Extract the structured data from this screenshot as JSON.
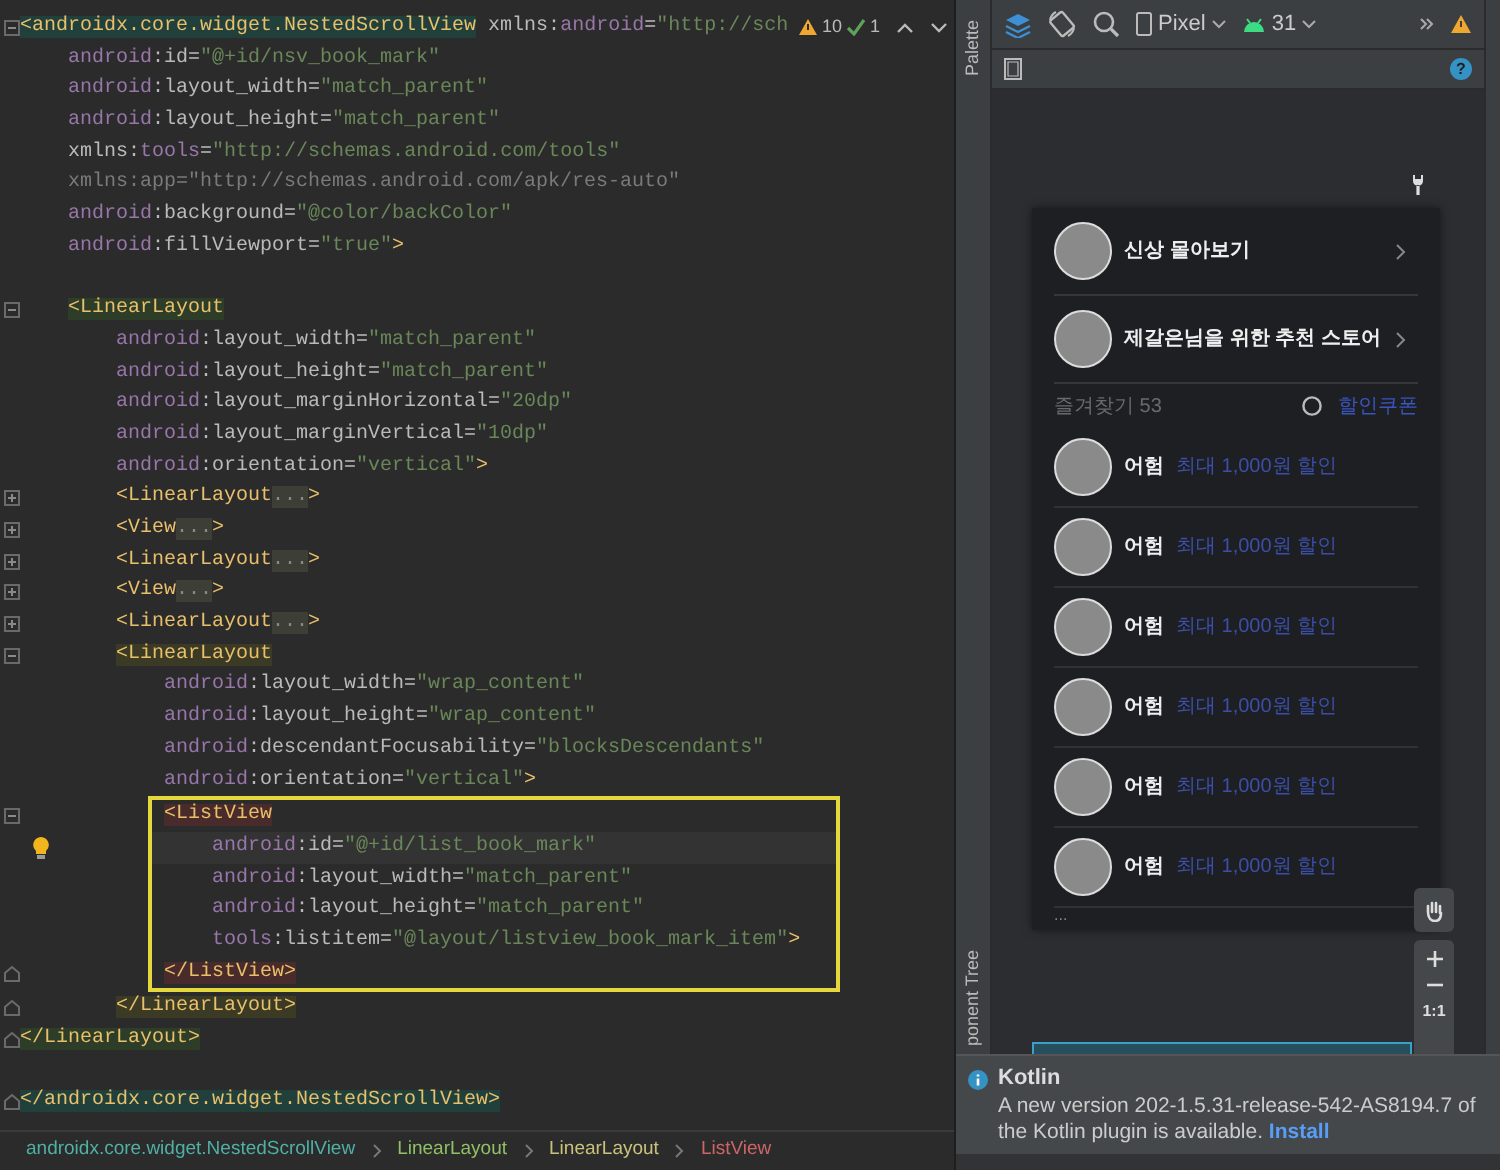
{
  "editor": {
    "inspections": {
      "warnings": "10",
      "weak_warnings": "1"
    },
    "lines": [
      {
        "kind": "code",
        "collapsed": false,
        "tokens": [
          {
            "kind": "tag",
            "text": "<androidx.core.widget.NestedScrollView",
            "color": "#22403b"
          },
          {
            "kind": "attr",
            "text": " xmlns:"
          },
          {
            "kind": "ns",
            "text": "android"
          },
          {
            "kind": "attr",
            "text": "="
          },
          {
            "kind": "val",
            "text": "\"http://sch"
          }
        ],
        "children": [
          {
            "kind": "code",
            "tokens": [
              {
                "kind": "ns",
                "text": "android"
              },
              {
                "kind": "attr",
                "text": ":id="
              },
              {
                "kind": "val",
                "text": "\"@+id/nsv_book_mark\""
              }
            ]
          },
          {
            "kind": "code",
            "tokens": [
              {
                "kind": "ns",
                "text": "android"
              },
              {
                "kind": "attr",
                "text": ":layout_width="
              },
              {
                "kind": "val",
                "text": "\"match_parent\""
              }
            ]
          },
          {
            "kind": "code",
            "tokens": [
              {
                "kind": "ns",
                "text": "android"
              },
              {
                "kind": "attr",
                "text": ":layout_height="
              },
              {
                "kind": "val",
                "text": "\"match_parent\""
              }
            ]
          },
          {
            "kind": "code",
            "tokens": [
              {
                "kind": "attr",
                "text": "xmlns:"
              },
              {
                "kind": "ns",
                "text": "tools"
              },
              {
                "kind": "attr",
                "text": "="
              },
              {
                "kind": "val",
                "text": "\"http://schemas.android.com/tools\""
              }
            ]
          },
          {
            "kind": "code",
            "tokens": [
              {
                "kind": "dim",
                "text": "xmlns:app=\"http://schemas.android.com/apk/res-auto\""
              }
            ]
          },
          {
            "kind": "code",
            "tokens": [
              {
                "kind": "ns",
                "text": "android"
              },
              {
                "kind": "attr",
                "text": ":background="
              },
              {
                "kind": "val",
                "text": "\"@color/backColor\""
              }
            ]
          },
          {
            "kind": "code",
            "tokens": [
              {
                "kind": "ns",
                "text": "android"
              },
              {
                "kind": "attr",
                "text": ":fillViewport="
              },
              {
                "kind": "val",
                "text": "\"true\""
              },
              {
                "kind": "tag",
                "text": ">"
              }
            ]
          },
          {
            "kind": "blank"
          },
          {
            "kind": "code",
            "collapsed": false,
            "tokens": [
              {
                "kind": "tag",
                "text": "<LinearLayout",
                "color": "#2e3d28"
              }
            ],
            "children": [
              {
                "kind": "code",
                "tokens": [
                  {
                    "kind": "ns",
                    "text": "android"
                  },
                  {
                    "kind": "attr",
                    "text": ":layout_width="
                  },
                  {
                    "kind": "val",
                    "text": "\"match_parent\""
                  }
                ]
              },
              {
                "kind": "code",
                "tokens": [
                  {
                    "kind": "ns",
                    "text": "android"
                  },
                  {
                    "kind": "attr",
                    "text": ":layout_height="
                  },
                  {
                    "kind": "val",
                    "text": "\"match_parent\""
                  }
                ]
              },
              {
                "kind": "code",
                "tokens": [
                  {
                    "kind": "ns",
                    "text": "android"
                  },
                  {
                    "kind": "attr",
                    "text": ":layout_marginHorizontal="
                  },
                  {
                    "kind": "val",
                    "text": "\"20dp\""
                  }
                ]
              },
              {
                "kind": "code",
                "tokens": [
                  {
                    "kind": "ns",
                    "text": "android"
                  },
                  {
                    "kind": "attr",
                    "text": ":layout_marginVertical="
                  },
                  {
                    "kind": "val",
                    "text": "\"10dp\""
                  }
                ]
              },
              {
                "kind": "code",
                "tokens": [
                  {
                    "kind": "ns",
                    "text": "android"
                  },
                  {
                    "kind": "attr",
                    "text": ":orientation="
                  },
                  {
                    "kind": "val",
                    "text": "\"vertical\""
                  },
                  {
                    "kind": "tag",
                    "text": ">"
                  }
                ]
              },
              {
                "kind": "code",
                "collapsed": true,
                "tokens": [
                  {
                    "kind": "tag",
                    "text": "<LinearLayout"
                  },
                  {
                    "kind": "fold",
                    "text": "..."
                  },
                  {
                    "kind": "tag",
                    "text": ">"
                  }
                ]
              },
              {
                "kind": "code",
                "collapsed": true,
                "tokens": [
                  {
                    "kind": "tag",
                    "text": "<View"
                  },
                  {
                    "kind": "fold",
                    "text": "..."
                  },
                  {
                    "kind": "tag",
                    "text": ">"
                  }
                ]
              },
              {
                "kind": "code",
                "collapsed": true,
                "tokens": [
                  {
                    "kind": "tag",
                    "text": "<LinearLayout"
                  },
                  {
                    "kind": "fold",
                    "text": "..."
                  },
                  {
                    "kind": "tag",
                    "text": ">"
                  }
                ]
              },
              {
                "kind": "code",
                "collapsed": true,
                "tokens": [
                  {
                    "kind": "tag",
                    "text": "<View"
                  },
                  {
                    "kind": "fold",
                    "text": "..."
                  },
                  {
                    "kind": "tag",
                    "text": ">"
                  }
                ]
              },
              {
                "kind": "code",
                "collapsed": true,
                "tokens": [
                  {
                    "kind": "tag",
                    "text": "<LinearLayout"
                  },
                  {
                    "kind": "fold",
                    "text": "..."
                  },
                  {
                    "kind": "tag",
                    "text": ">"
                  }
                ]
              },
              {
                "kind": "code",
                "collapsed": false,
                "tokens": [
                  {
                    "kind": "tag",
                    "text": "<LinearLayout",
                    "color": "#3b3a25"
                  }
                ],
                "children": [
                  {
                    "kind": "code",
                    "tokens": [
                      {
                        "kind": "ns",
                        "text": "android"
                      },
                      {
                        "kind": "attr",
                        "text": ":layout_width="
                      },
                      {
                        "kind": "val",
                        "text": "\"wrap_content\""
                      }
                    ]
                  },
                  {
                    "kind": "code",
                    "tokens": [
                      {
                        "kind": "ns",
                        "text": "android"
                      },
                      {
                        "kind": "attr",
                        "text": ":layout_height="
                      },
                      {
                        "kind": "val",
                        "text": "\"wrap_content\""
                      }
                    ]
                  },
                  {
                    "kind": "code",
                    "tokens": [
                      {
                        "kind": "ns",
                        "text": "android"
                      },
                      {
                        "kind": "attr",
                        "text": ":descendantFocusability="
                      },
                      {
                        "kind": "val",
                        "text": "\"blocksDescendants\""
                      }
                    ]
                  },
                  {
                    "kind": "code",
                    "tokens": [
                      {
                        "kind": "ns",
                        "text": "android"
                      },
                      {
                        "kind": "attr",
                        "text": ":orientation="
                      },
                      {
                        "kind": "val",
                        "text": "\"vertical\""
                      },
                      {
                        "kind": "tag",
                        "text": ">"
                      }
                    ]
                  },
                  {
                    "kind": "box",
                    "lines": [
                      {
                        "kind": "code",
                        "collapsed": false,
                        "tokens": [
                          {
                            "kind": "tag",
                            "text": "<ListView",
                            "color": "#4a2b2b"
                          }
                        ],
                        "children": [
                          {
                            "kind": "code",
                            "intention": true,
                            "tokens": [
                              {
                                "kind": "ns",
                                "text": "android"
                              },
                              {
                                "kind": "attr",
                                "text": ":id="
                              },
                              {
                                "kind": "val",
                                "text": "\"@+id/list_book_mark\""
                              }
                            ]
                          },
                          {
                            "kind": "code",
                            "tokens": [
                              {
                                "kind": "ns",
                                "text": "android"
                              },
                              {
                                "kind": "attr",
                                "text": ":layout_width="
                              },
                              {
                                "kind": "val",
                                "text": "\"match_parent\""
                              }
                            ]
                          },
                          {
                            "kind": "code",
                            "tokens": [
                              {
                                "kind": "ns",
                                "text": "android"
                              },
                              {
                                "kind": "attr",
                                "text": ":layout_height="
                              },
                              {
                                "kind": "val",
                                "text": "\"match_parent\""
                              }
                            ]
                          },
                          {
                            "kind": "code",
                            "tokens": [
                              {
                                "kind": "ns",
                                "text": "tools"
                              },
                              {
                                "kind": "attr",
                                "text": ":listitem="
                              },
                              {
                                "kind": "val",
                                "text": "\"@layout/listview_book_mark_item\""
                              },
                              {
                                "kind": "tag",
                                "text": ">"
                              }
                            ]
                          }
                        ]
                      },
                      {
                        "kind": "code",
                        "block_end": true,
                        "tokens": [
                          {
                            "kind": "tag",
                            "text": "</ListView>",
                            "color": "#4a2b2b"
                          }
                        ]
                      }
                    ]
                  }
                ]
              },
              {
                "kind": "code",
                "block_end": true,
                "tokens": [
                  {
                    "kind": "tag",
                    "text": "</LinearLayout>",
                    "color": "#3b3a25"
                  }
                ]
              }
            ]
          }
        ]
      },
      {
        "kind": "code",
        "block_end": true,
        "tokens": [
          {
            "kind": "tag",
            "text": "</LinearLayout>",
            "color": "#2e3d28"
          }
        ]
      },
      {
        "kind": "blank"
      },
      {
        "kind": "code",
        "block_end": true,
        "tokens": [
          {
            "kind": "tag",
            "text": "</androidx.core.widget.NestedScrollView>",
            "color": "#22403b"
          }
        ]
      }
    ],
    "breadcrumbs": [
      {
        "label": "androidx.core.widget.NestedScrollView",
        "color": "#4fb0a5"
      },
      {
        "label": "LinearLayout",
        "color": "#8fc064"
      },
      {
        "label": "LinearLayout",
        "color": "#c9c27a"
      },
      {
        "label": "ListView",
        "color": "#cc6666"
      }
    ]
  },
  "design": {
    "toolbar": {
      "device": "Pixel",
      "api": "31"
    },
    "help": "?",
    "side_tabs": [
      "Palette",
      "ponent Tree"
    ],
    "preview": {
      "menu": [
        {
          "label": "신상 몰아보기"
        },
        {
          "label": "제갈은님을 위한 추천 스토어"
        }
      ],
      "section_label": "즐겨찾기 53",
      "coupon_link": "할인쿠폰",
      "items": [
        {
          "name": "어험",
          "discount": "최대 1,000원 할인"
        },
        {
          "name": "어험",
          "discount": "최대 1,000원 할인"
        },
        {
          "name": "어험",
          "discount": "최대 1,000원 할인"
        },
        {
          "name": "어험",
          "discount": "최대 1,000원 할인"
        },
        {
          "name": "어험",
          "discount": "최대 1,000원 할인"
        },
        {
          "name": "어험",
          "discount": "최대 1,000원 할인"
        }
      ],
      "more": "..."
    },
    "zoom": {
      "reset": "1:1"
    }
  },
  "notification": {
    "title": "Kotlin",
    "message": "A new version 202-1.5.31-release-542-AS8194.7 of the Kotlin plugin is available.",
    "action": "Install"
  }
}
